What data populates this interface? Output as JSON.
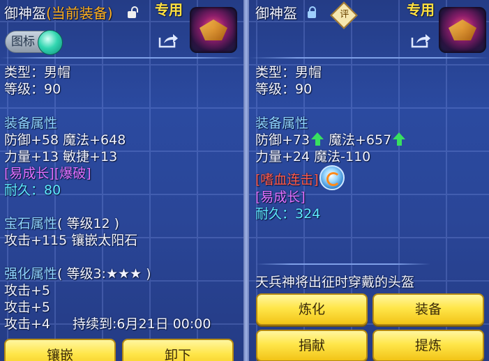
{
  "left": {
    "title": "御神盔",
    "title_suffix": "(当前装备)",
    "exclusive": "专用",
    "icon_toggle_label": "图标",
    "type": "类型：男帽",
    "level": "等级：90",
    "attr_header": "装备属性",
    "attr_line1": "防御+58 魔法+648",
    "attr_line2": "力量+13 敏捷+13",
    "tag_growth": "[易成长]",
    "tag_burst": "[爆破]",
    "durability_label": "耐久：",
    "durability_value": "80",
    "gem_header": "宝石属性",
    "gem_level": "( 等级12 )",
    "gem_line": "攻击+115 镶嵌太阳石",
    "enh_header": "强化属性",
    "enh_level": "( 等级3:★★★ )",
    "enh_line1": "攻击+5",
    "enh_line2": "攻击+5",
    "enh_line3": "攻击+4",
    "enh_duration": "持续到:6月21日 00:00",
    "btn_inlay": "镶嵌",
    "btn_unequip": "卸下"
  },
  "right": {
    "title": "御神盔",
    "rate_badge": "评",
    "exclusive": "专用",
    "type": "类型：男帽",
    "level": "等级：90",
    "attr_header": "装备属性",
    "attr_def": "防御+73",
    "attr_magic": "魔法+657",
    "attr_line2": "力量+24 魔法-110",
    "skill_tag": "[嗜血连击]",
    "tag_growth": "[易成长]",
    "durability_label": "耐久：",
    "durability_value": "324",
    "description": "天兵神将出征时穿戴的头盔",
    "btn_refine": "炼化",
    "btn_equip": "装备",
    "btn_donate": "捐献",
    "btn_extract": "提炼"
  },
  "colors": {
    "orange_title": "#ffb020",
    "section_blue": "#8fd4ff",
    "purple_tag": "#e070ff",
    "red_tag": "#ff5a4a",
    "durability_cyan": "#5ee8ff",
    "button_yellow": "#ffe64a"
  },
  "icons": [
    "lock-open-icon",
    "lock-closed-icon",
    "share-icon",
    "helmet-icon",
    "rating-badge-icon",
    "up-arrow-icon",
    "skill-icon"
  ]
}
